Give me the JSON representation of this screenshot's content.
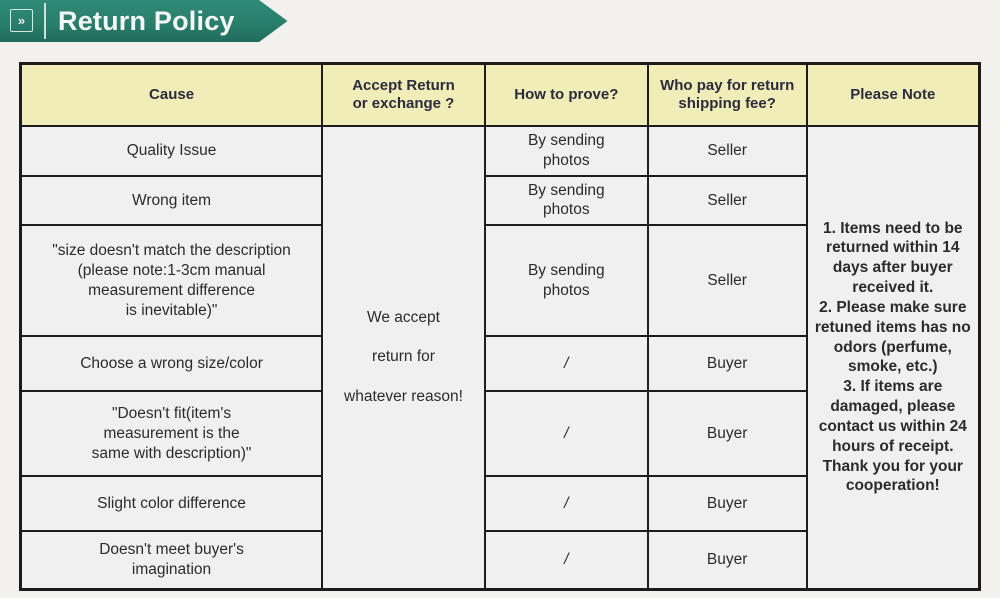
{
  "banner": {
    "title": "Return Policy",
    "icon": "chevron-right-icon",
    "icon_glyph": "»",
    "background_color": "#2a7e6c",
    "text_color": "#f4f7f6"
  },
  "table": {
    "header_background": "#f0edb8",
    "cell_background": "#f0f0f0",
    "border_color": "#1d1d1d",
    "headers": [
      "Cause",
      "Accept Return\nor exchange ?",
      "How to prove?",
      "Who pay for return\nshipping fee?",
      "Please Note"
    ],
    "accept_return_merged": "We accept\n\nreturn for\n\nwhatever reason!",
    "please_note_merged": "1. Items need to be returned within 14 days after buyer received it.\n2. Please make sure retuned items has no odors (perfume, smoke, etc.)\n3. If items are damaged, please contact us within 24 hours of receipt.\nThank you for your cooperation!",
    "rows": [
      {
        "cause": "Quality Issue",
        "how_to_prove": "By sending\nphotos",
        "who_pays": "Seller"
      },
      {
        "cause": "Wrong item",
        "how_to_prove": "By sending\nphotos",
        "who_pays": "Seller"
      },
      {
        "cause": "\"size doesn't match the description\n(please note:1-3cm manual\nmeasurement difference\nis inevitable)\"",
        "how_to_prove": "By sending\nphotos",
        "who_pays": "Seller"
      },
      {
        "cause": "Choose a wrong size/color",
        "how_to_prove": "/",
        "who_pays": "Buyer"
      },
      {
        "cause": "\"Doesn't fit(item's\nmeasurement is the\nsame with description)\"",
        "how_to_prove": "/",
        "who_pays": "Buyer"
      },
      {
        "cause": "Slight color difference",
        "how_to_prove": "/",
        "who_pays": "Buyer"
      },
      {
        "cause": "Doesn't meet buyer's\nimagination",
        "how_to_prove": "/",
        "who_pays": "Buyer"
      }
    ]
  }
}
